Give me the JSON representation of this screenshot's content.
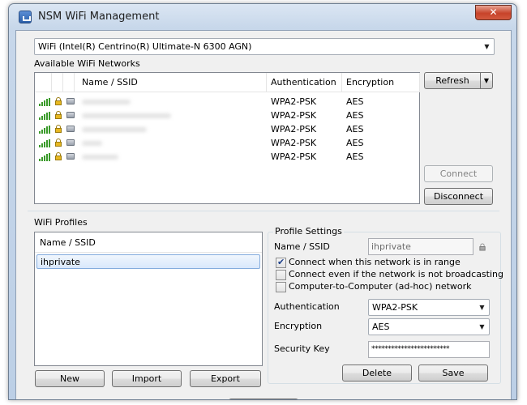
{
  "window": {
    "title": "NSM WiFi Management",
    "close_glyph": "✕"
  },
  "adapter": {
    "selected": "WiFi (Intel(R) Centrino(R) Ultimate-N 6300 AGN)"
  },
  "networks": {
    "section_label": "Available WiFi Networks",
    "columns": {
      "name": "Name / SSID",
      "auth": "Authentication",
      "enc": "Encryption"
    },
    "rows": [
      {
        "auth": "WPA2-PSK",
        "enc": "AES"
      },
      {
        "auth": "WPA2-PSK",
        "enc": "AES"
      },
      {
        "auth": "WPA2-PSK",
        "enc": "AES"
      },
      {
        "auth": "WPA2-PSK",
        "enc": "AES"
      },
      {
        "auth": "WPA2-PSK",
        "enc": "AES"
      }
    ],
    "refresh_label": "Refresh",
    "connect_label": "Connect",
    "disconnect_label": "Disconnect"
  },
  "profiles": {
    "section_label": "WiFi Profiles",
    "column": "Name / SSID",
    "items": [
      "ihprivate"
    ],
    "new_label": "New",
    "import_label": "Import",
    "export_label": "Export"
  },
  "settings": {
    "section_label": "Profile Settings",
    "name_label": "Name / SSID",
    "name_value": "ihprivate",
    "check_auto_connect": "Connect when this network is in range",
    "check_not_broadcasting": "Connect even if the network is not broadcasting",
    "check_adhoc": "Computer-to-Computer (ad-hoc) network",
    "auth_label": "Authentication",
    "auth_value": "WPA2-PSK",
    "enc_label": "Encryption",
    "enc_value": "AES",
    "key_label": "Security Key",
    "key_value": "************************",
    "delete_label": "Delete",
    "save_label": "Save"
  },
  "colors": {
    "accent_selection": "#84acdd",
    "signal": "#3a9a2a"
  }
}
